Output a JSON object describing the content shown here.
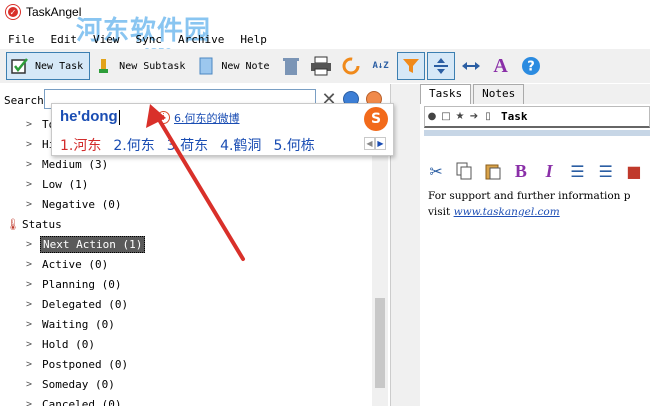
{
  "window": {
    "title": "TaskAngel",
    "app_icon": "✓"
  },
  "watermark": {
    "text": "河东软件园",
    "url": "www.pc0359.cn"
  },
  "menubar": {
    "items": [
      "File",
      "Edit",
      "View",
      "Sync",
      "Archive",
      "Help"
    ]
  },
  "toolbar": {
    "new_task": "New Task",
    "new_subtask": "New Subtask",
    "new_note": "New Note",
    "sort_label": "A↓Z"
  },
  "search": {
    "label": "Search",
    "value": "",
    "clear_glyph": "✕"
  },
  "tree": {
    "rows": [
      {
        "text": "To",
        "kind": "item"
      },
      {
        "text": "Hi",
        "kind": "item"
      },
      {
        "text": "Medium (3)",
        "kind": "item"
      },
      {
        "text": "Low (1)",
        "kind": "item"
      },
      {
        "text": "Negative (0)",
        "kind": "item"
      }
    ],
    "status_group": "Status",
    "status_rows": [
      {
        "text": "Next Action (1)",
        "selected": true
      },
      {
        "text": "Active (0)"
      },
      {
        "text": "Planning (0)"
      },
      {
        "text": "Delegated (0)"
      },
      {
        "text": "Waiting (0)"
      },
      {
        "text": "Hold (0)"
      },
      {
        "text": "Postponed (0)"
      },
      {
        "text": "Someday (0)"
      },
      {
        "text": "Canceled (0)"
      }
    ]
  },
  "right_pane": {
    "tabs": [
      "Tasks",
      "Notes"
    ],
    "task_header": "Task",
    "note_line1": "For support and further information p",
    "note_line2_prefix": "visit ",
    "note_link": "www.taskangel.com"
  },
  "ime": {
    "pinyin": "he'dong",
    "suggestion": "6.何东的微博",
    "logo": "S",
    "candidates": [
      "1.河东",
      "2.何东",
      "3.荷东",
      "4.鹤洞",
      "5.何栋"
    ],
    "nav_prev": "◀",
    "nav_next": "▶"
  },
  "colors": {
    "accent": "#1a4db3",
    "arrow": "#d9302a",
    "selected_bg": "#5a5a5a"
  }
}
